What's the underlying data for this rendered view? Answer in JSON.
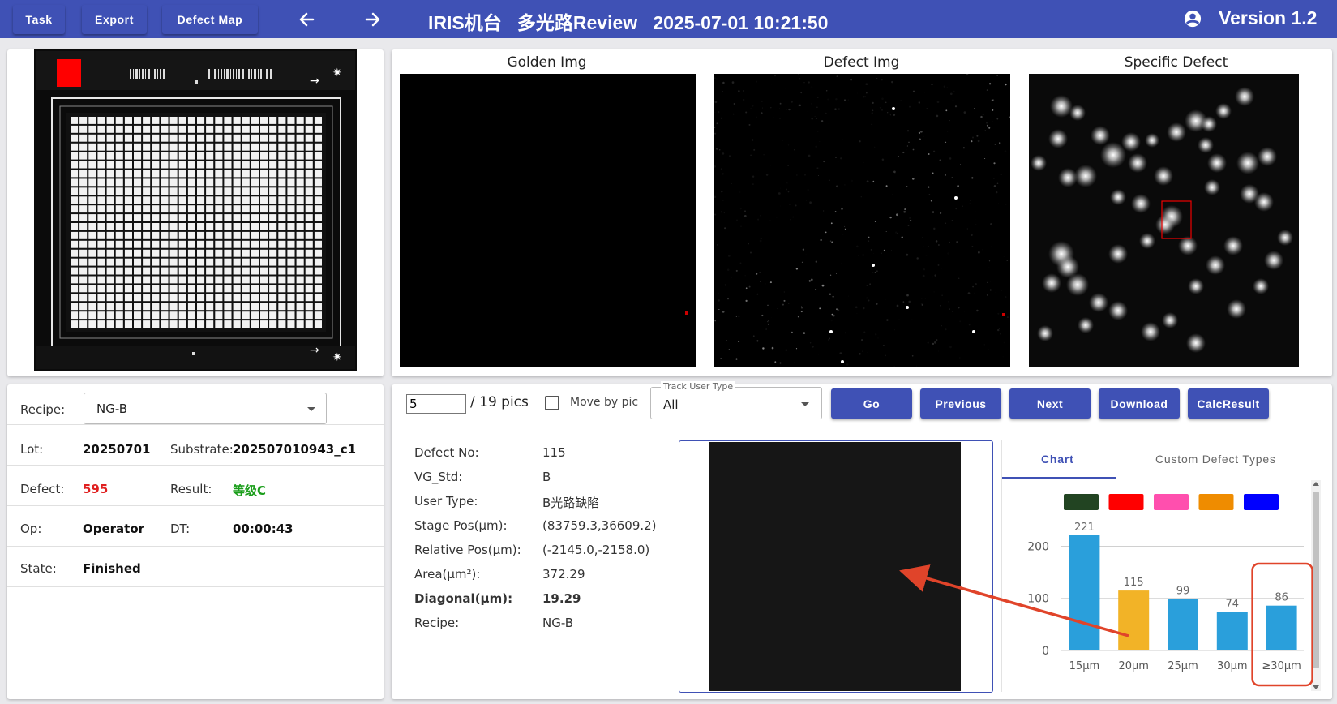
{
  "toolbar": {
    "task_label": "Task",
    "export_label": "Export",
    "defect_map_label": "Defect Map",
    "title": "IRIS机台   多光路Review   2025-07-01 10:21:50",
    "version": "Version 1.2"
  },
  "images": {
    "golden_title": "Golden Img",
    "defect_title": "Defect Img",
    "specific_title": "Specific Defect"
  },
  "info": {
    "recipe_label": "Recipe:",
    "recipe_value": "NG-B",
    "lot_label": "Lot:",
    "lot_value": "20250701",
    "substrate_label": "Substrate:",
    "substrate_value": "202507010943_c1",
    "defect_label": "Defect:",
    "defect_value": "595",
    "result_label": "Result:",
    "result_value": "等级C",
    "op_label": "Op:",
    "op_value": "Operator",
    "dt_label": "DT:",
    "dt_value": "00:00:43",
    "state_label": "State:",
    "state_value": "Finished"
  },
  "nav": {
    "page_value": "5",
    "page_total": "/ 19 pics",
    "move_by_pic_label": "Move by pic",
    "track_user_type_label": "Track User Type",
    "track_user_type_value": "All",
    "go_label": "Go",
    "previous_label": "Previous",
    "next_label": "Next",
    "download_label": "Download",
    "calc_label": "CalcResult"
  },
  "detail": {
    "rows": [
      {
        "label": "Defect No:",
        "value": "115"
      },
      {
        "label": "VG_Std:",
        "value": "B"
      },
      {
        "label": "User Type:",
        "value": "B光路缺陷"
      },
      {
        "label": "Stage Pos(μm):",
        "value": "(83759.3,36609.2)"
      },
      {
        "label": "Relative Pos(μm):",
        "value": "(-2145.0,-2158.0)"
      },
      {
        "label": "Area(μm²):",
        "value": "372.29"
      },
      {
        "label": "Diagonal(μm):",
        "value": "19.29"
      },
      {
        "label": "Recipe:",
        "value": "NG-B"
      }
    ]
  },
  "tabs": {
    "chart_label": "Chart",
    "custom_label": "Custom Defect Types"
  },
  "legend_colors": [
    "#224422",
    "#ff0000",
    "#ff4fae",
    "#ef8c00",
    "#0000ff"
  ],
  "chart_data": {
    "type": "bar",
    "categories": [
      "15μm",
      "20μm",
      "25μm",
      "30μm",
      "≥30μm"
    ],
    "values": [
      221,
      115,
      99,
      74,
      86
    ],
    "bar_colors": [
      "#2a9fdb",
      "#f2b327",
      "#2a9fdb",
      "#2a9fdb",
      "#2a9fdb"
    ],
    "highlight_index": 1,
    "yticks": [
      0,
      100,
      200
    ],
    "ylim": [
      0,
      221
    ],
    "grid": true,
    "annotation_box_index": 4
  }
}
